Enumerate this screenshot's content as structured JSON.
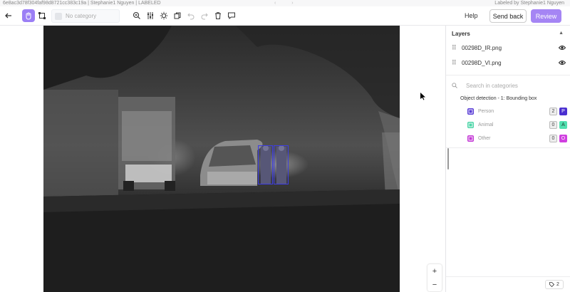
{
  "header": {
    "meta": "6e8ac3d78f304faf98d8721cc383c19a | Stephanie1 Nguyen | LABELED",
    "nav_prev": "‹",
    "nav_next": "›",
    "labeled_by": "Labeled by Stephanie1 Nguyen"
  },
  "toolbar": {
    "category_placeholder": "No category",
    "help_label": "Help",
    "send_back_label": "Send back",
    "review_label": "Review",
    "accent_color": "#9b7ff5"
  },
  "canvas": {
    "zoom_in_label": "+",
    "zoom_out_label": "−",
    "annotations": [
      {
        "category": "Person"
      },
      {
        "category": "Person"
      }
    ]
  },
  "panel": {
    "layers_title": "Layers",
    "layers": [
      {
        "name": "00298D_IR.png",
        "visible": true
      },
      {
        "name": "00298D_VI.png",
        "visible": true
      }
    ],
    "search_placeholder": "Search in categories",
    "group_title": "Object detection - 1: Bounding box",
    "categories": [
      {
        "label": "Person",
        "count": "2",
        "key": "P",
        "color": "#5b3fd6",
        "key_bg": "#4a2fd0",
        "key_fg": "#ffffff"
      },
      {
        "label": "Animal",
        "count": "0",
        "key": "A",
        "color": "#4fd6a8",
        "key_bg": "#52e0b0",
        "key_fg": "#1a3a2f"
      },
      {
        "label": "Other",
        "count": "0",
        "key": "O",
        "color": "#c43ad6",
        "key_bg": "#d03fe0",
        "key_fg": "#ffffff"
      }
    ],
    "tag_count": "2"
  }
}
